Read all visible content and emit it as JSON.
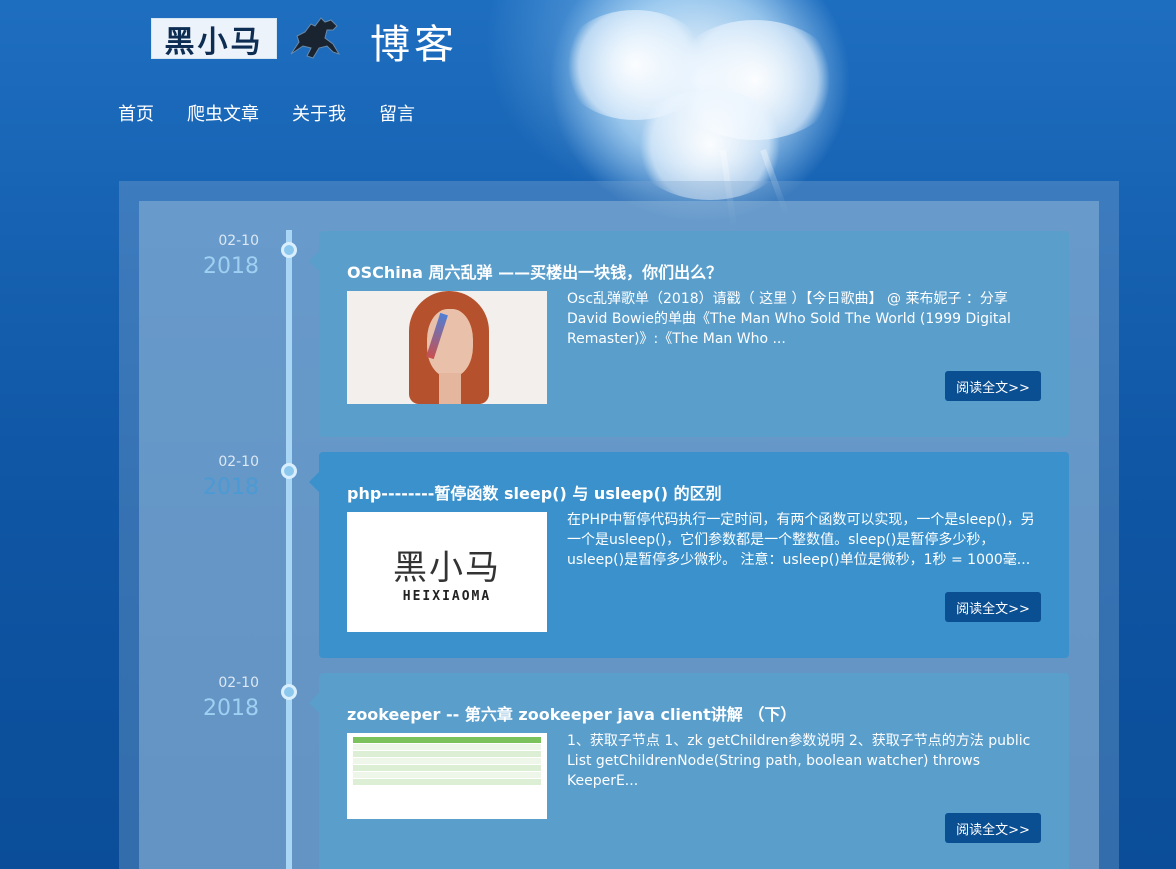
{
  "header": {
    "logo_text": "黑小马",
    "title": "博客"
  },
  "nav": {
    "items": [
      "首页",
      "爬虫文章",
      "关于我",
      "留言"
    ]
  },
  "posts": [
    {
      "date_md": "02-10",
      "year": "2018",
      "title": "OSChina 周六乱弹 ——买楼出一块钱，你们出么？",
      "excerpt": "Osc乱弹歌单（2018）请戳（ 这里 ）【今日歌曲】 @ 莱布妮子 ：分享 David Bowie的单曲《The Man Who Sold The World (1999 Digital Remaster)》:《The Man Who ...",
      "read_more": "阅读全文>>"
    },
    {
      "date_md": "02-10",
      "year": "2018",
      "title": "php--------暂停函数 sleep() 与 usleep() 的区别",
      "excerpt": "在PHP中暂停代码执行一定时间，有两个函数可以实现，一个是sleep()，另一个是usleep()，它们参数都是一个整数值。sleep()是暂停多少秒，usleep()是暂停多少微秒。 注意：usleep()单位是微秒，1秒 = 1000毫...",
      "read_more": "阅读全文>>",
      "thumb_big": "黑小马",
      "thumb_small": "HEIXIAOMA"
    },
    {
      "date_md": "02-10",
      "year": "2018",
      "title": "zookeeper -- 第六章 zookeeper java client讲解 （下）",
      "excerpt": "1、获取子节点 1、zk getChildren参数说明 2、获取子节点的方法 public List getChildrenNode(String path, boolean watcher) throws KeeperE...",
      "read_more": "阅读全文>>"
    }
  ]
}
